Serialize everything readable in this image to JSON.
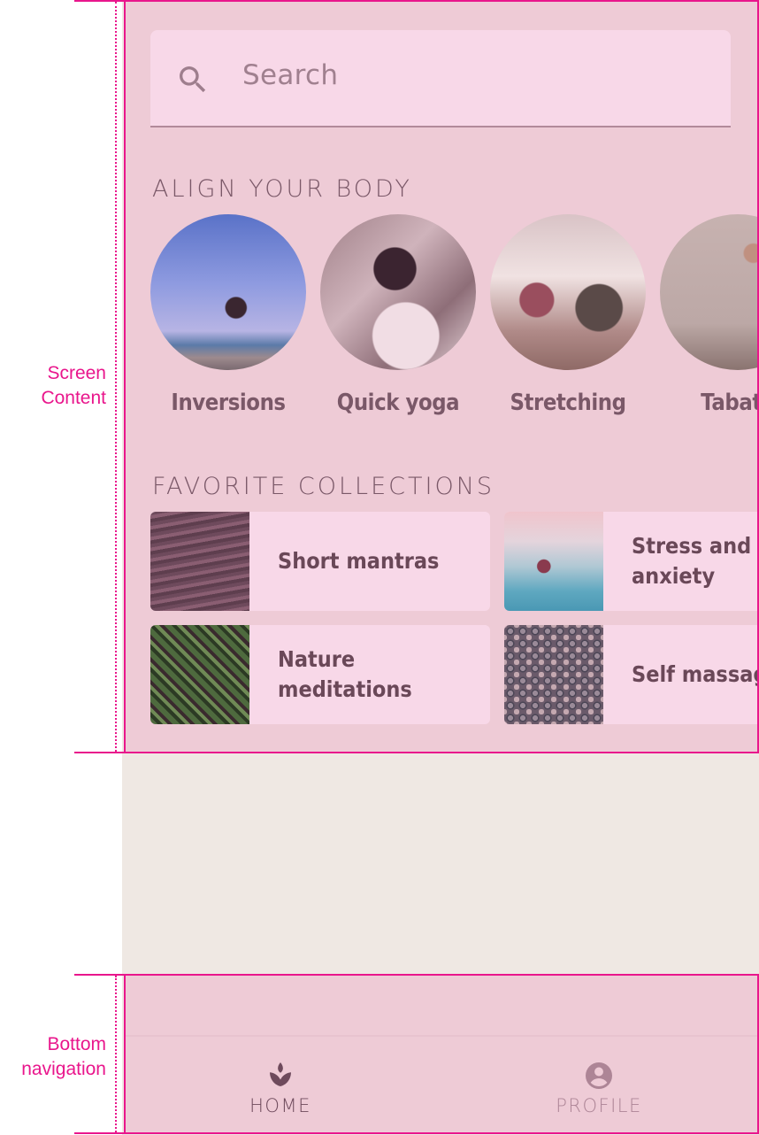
{
  "annotations": {
    "screen_content_label": "Screen\nContent",
    "screen_content_line1": "Screen",
    "screen_content_line2": "Content",
    "bottom_nav_line1": "Bottom",
    "bottom_nav_line2": "navigation",
    "color": "#e9168c"
  },
  "search": {
    "placeholder": "Search",
    "icon": "search-icon"
  },
  "align_your_body": {
    "title": "ALIGN YOUR BODY",
    "items": [
      {
        "label": "Inversions"
      },
      {
        "label": "Quick yoga"
      },
      {
        "label": "Stretching"
      },
      {
        "label": "Tabata"
      }
    ]
  },
  "favorite_collections": {
    "title": "FAVORITE COLLECTIONS",
    "items": [
      {
        "label": "Short mantras"
      },
      {
        "label": "Stress and\nanxiety"
      },
      {
        "label": "Nature\nmeditations"
      },
      {
        "label": "Self massage"
      }
    ]
  },
  "bottom_nav": {
    "items": [
      {
        "label": "HOME",
        "icon": "spa-icon",
        "active": true
      },
      {
        "label": "PROFILE",
        "icon": "account-circle-icon",
        "active": false
      }
    ]
  },
  "colors": {
    "surface": "#eecbd6",
    "card": "#f8d8e8",
    "text_primary": "#6a4858",
    "text_secondary": "#a0808f",
    "background": "#efe8e3"
  }
}
